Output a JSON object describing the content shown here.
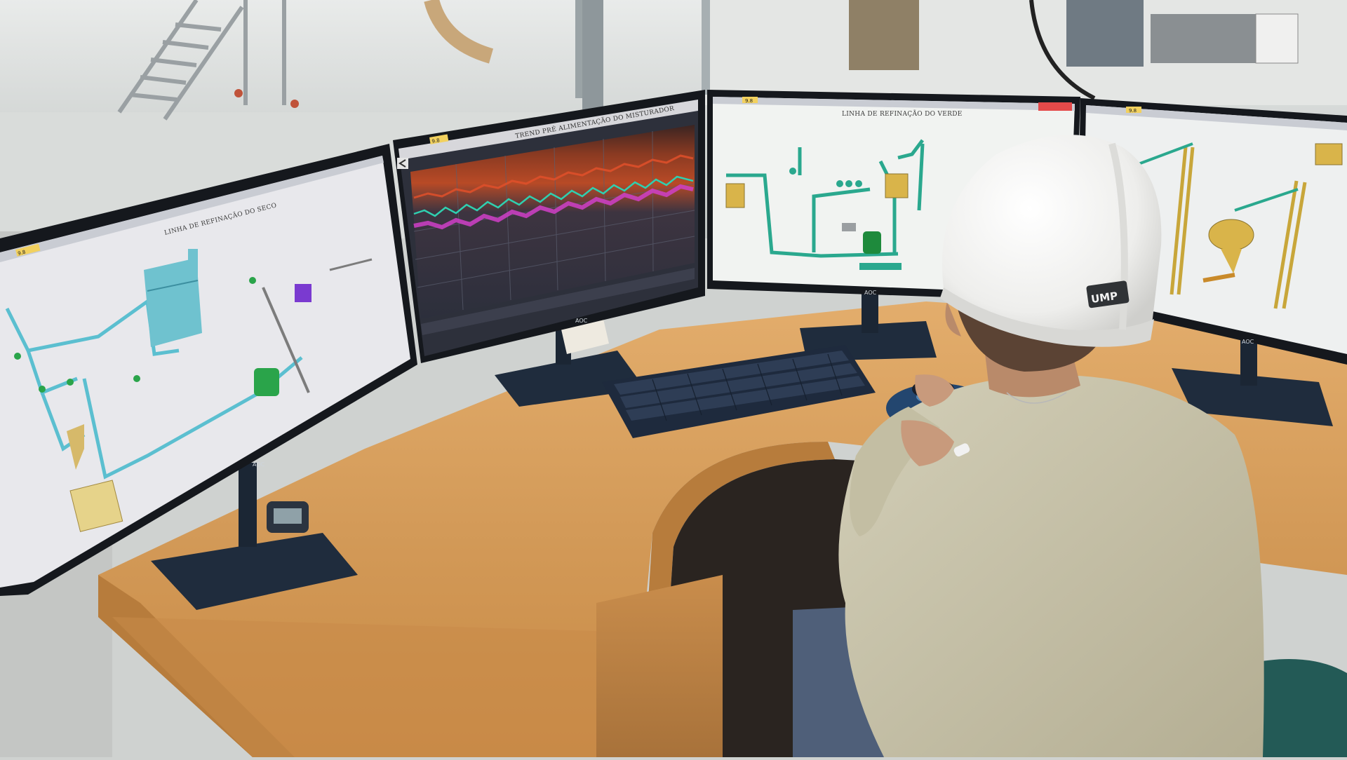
{
  "monitors": {
    "left": {
      "title": "LINHA DE REFINAÇÃO DO SECO",
      "tab_label": "9.8",
      "brand": "AOC",
      "accent": "#5bbfd0"
    },
    "center_left": {
      "title": "TREND PRÉ ALIMENTAÇÃO DO MISTURADOR",
      "tab_label": "9.8",
      "brand": "AOC",
      "series_colors": [
        "#e0502a",
        "#2fd0b0",
        "#d040c8"
      ]
    },
    "center_right": {
      "title": "LINHA DE REFINAÇÃO DO VERDE",
      "tab_label": "9.8",
      "brand": "AOC",
      "accent": "#2aa88e"
    },
    "right": {
      "tab_label": "9.8",
      "brand": "AOC",
      "accent": "#d6b23a"
    }
  },
  "hard_hat": {
    "logo_text": "UMP"
  },
  "colors": {
    "desk": "#d6a061",
    "desk_edge": "#b57b3f",
    "monitor_stand": "#1f2c3d",
    "shirt": "#c9c4aa",
    "helmet": "#f3f3f1"
  }
}
